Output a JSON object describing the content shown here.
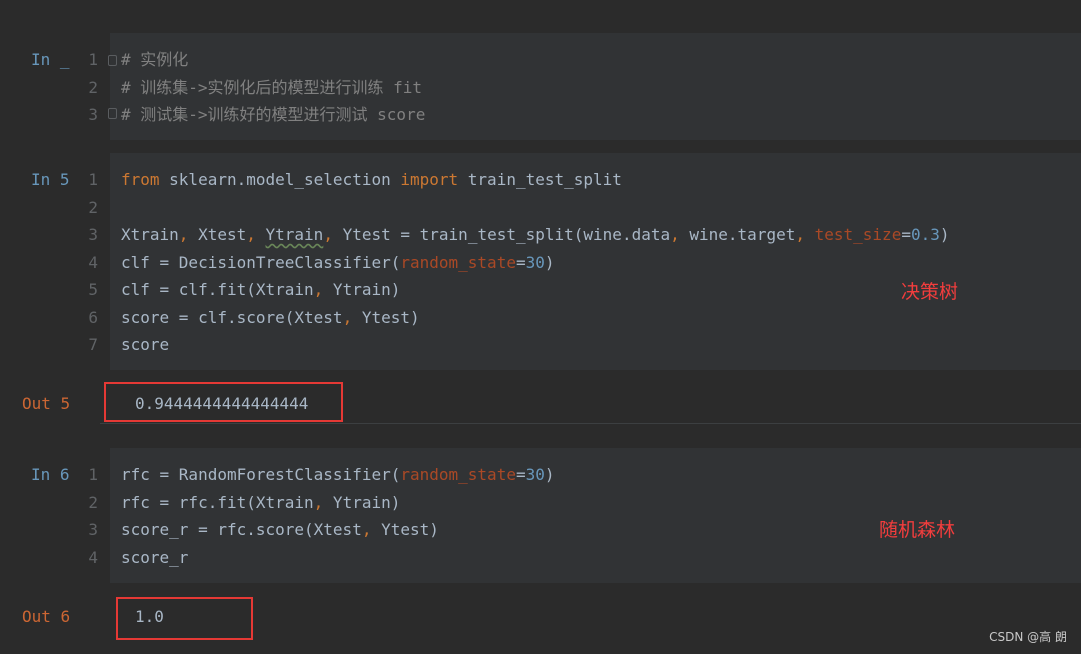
{
  "cells": [
    {
      "prompt": "In _",
      "lines": [
        [
          {
            "t": "# 实例化",
            "c": "cm"
          }
        ],
        [
          {
            "t": "# 训练集->实例化后的模型进行训练 fit",
            "c": "cm"
          }
        ],
        [
          {
            "t": "# 测试集->训练好的模型进行测试 score",
            "c": "cm"
          }
        ]
      ]
    },
    {
      "prompt": "In 5",
      "lines": [
        [
          {
            "t": "from",
            "c": "kw"
          },
          {
            "t": " sklearn.model_selection "
          },
          {
            "t": "import",
            "c": "kw"
          },
          {
            "t": " train_test_split"
          }
        ],
        [],
        [
          {
            "t": "Xtrain"
          },
          {
            "t": ",",
            "c": "pn"
          },
          {
            "t": " Xtest"
          },
          {
            "t": ",",
            "c": "pn"
          },
          {
            "t": " "
          },
          {
            "t": "Ytrain",
            "c": "sq"
          },
          {
            "t": ",",
            "c": "pn"
          },
          {
            "t": " Ytest = train_test_split(wine.data"
          },
          {
            "t": ",",
            "c": "pn"
          },
          {
            "t": " wine.target"
          },
          {
            "t": ",",
            "c": "pn"
          },
          {
            "t": " "
          },
          {
            "t": "test_size",
            "c": "prm"
          },
          {
            "t": "="
          },
          {
            "t": "0.3",
            "c": "num"
          },
          {
            "t": ")"
          }
        ],
        [
          {
            "t": "clf = DecisionTreeClassifier("
          },
          {
            "t": "random_state",
            "c": "prm"
          },
          {
            "t": "="
          },
          {
            "t": "30",
            "c": "num"
          },
          {
            "t": ")"
          }
        ],
        [
          {
            "t": "clf = clf.fit(Xtrain"
          },
          {
            "t": ",",
            "c": "pn"
          },
          {
            "t": " Ytrain)"
          }
        ],
        [
          {
            "t": "score = clf.score(Xtest"
          },
          {
            "t": ",",
            "c": "pn"
          },
          {
            "t": " Ytest)"
          }
        ],
        [
          {
            "t": "score"
          }
        ]
      ],
      "annotation": "决策树",
      "out_prompt": "Out 5",
      "output": "0.9444444444444444"
    },
    {
      "prompt": "In 6",
      "lines": [
        [
          {
            "t": "rfc = RandomForestClassifier("
          },
          {
            "t": "random_state",
            "c": "prm"
          },
          {
            "t": "="
          },
          {
            "t": "30",
            "c": "num"
          },
          {
            "t": ")"
          }
        ],
        [
          {
            "t": "rfc = rfc.fit(Xtrain"
          },
          {
            "t": ",",
            "c": "pn"
          },
          {
            "t": " Ytrain)"
          }
        ],
        [
          {
            "t": "score_r = rfc.score(Xtest"
          },
          {
            "t": ",",
            "c": "pn"
          },
          {
            "t": " Ytest)"
          }
        ],
        [
          {
            "t": "score_r"
          }
        ]
      ],
      "annotation": "随机森林",
      "out_prompt": "Out 6",
      "output": "1.0"
    }
  ],
  "watermark": "CSDN @高 朗"
}
